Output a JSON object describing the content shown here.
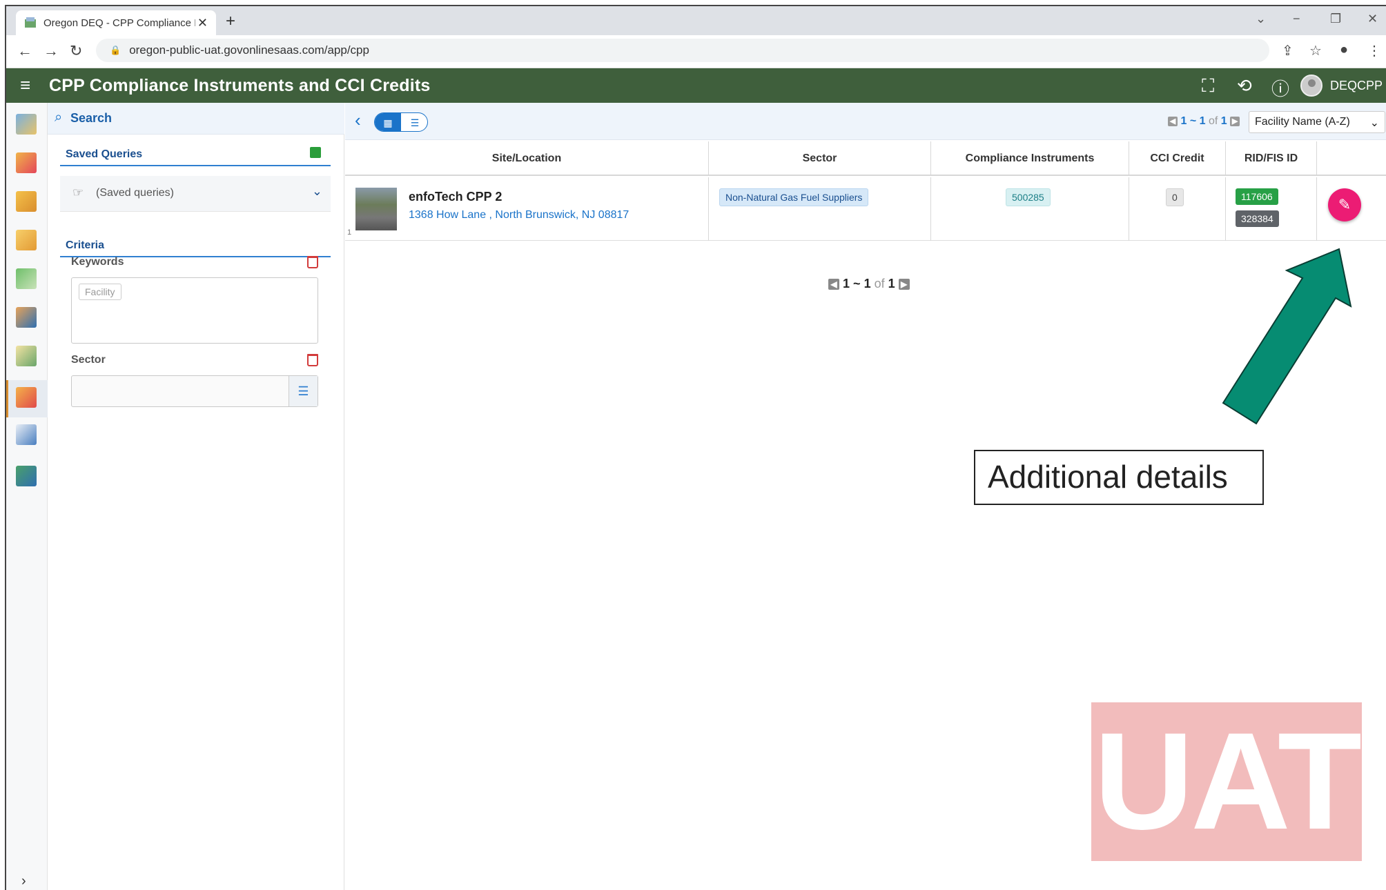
{
  "browser": {
    "tab_title": "Oregon DEQ - CPP Compliance I",
    "tab_close": "✕",
    "new_tab": "+",
    "url": "oregon-public-uat.govonlinesaas.com/app/cpp",
    "nav_back": "←",
    "nav_forward": "→",
    "nav_reload": "↻",
    "win_minimize": "−",
    "win_restore": "❐",
    "win_close": "✕",
    "win_dropdown": "⌄"
  },
  "app": {
    "title": "CPP Compliance Instruments and CCI Credits",
    "user": "DEQCPP",
    "header_color": "#3f5f3c"
  },
  "search": {
    "header": "Search",
    "saved_queries_label": "Saved Queries",
    "saved_queries_placeholder": "(Saved queries)",
    "criteria_label": "Criteria",
    "keywords_label": "Keywords",
    "keywords_chip": "Facility",
    "sector_label": "Sector"
  },
  "results": {
    "pager": {
      "start": "1",
      "sep": "~",
      "end": "1",
      "of": "of",
      "total": "1"
    },
    "sort": "Facility Name (A-Z)",
    "columns": [
      "Site/Location",
      "Sector",
      "Compliance Instruments",
      "CCI Credit",
      "RID/FIS ID"
    ],
    "rows": [
      {
        "num": "1",
        "name": "enfoTech CPP 2",
        "address": "1368 How Lane , North Brunswick, NJ 08817",
        "sector": "Non-Natural Gas Fuel Suppliers",
        "compliance_instrument": "500285",
        "cci_credit": "0",
        "rid": "117606",
        "fis_id": "328384"
      }
    ]
  },
  "annotation": {
    "callout": "Additional details",
    "watermark": "UAT",
    "arrow_color": "#068c72"
  }
}
